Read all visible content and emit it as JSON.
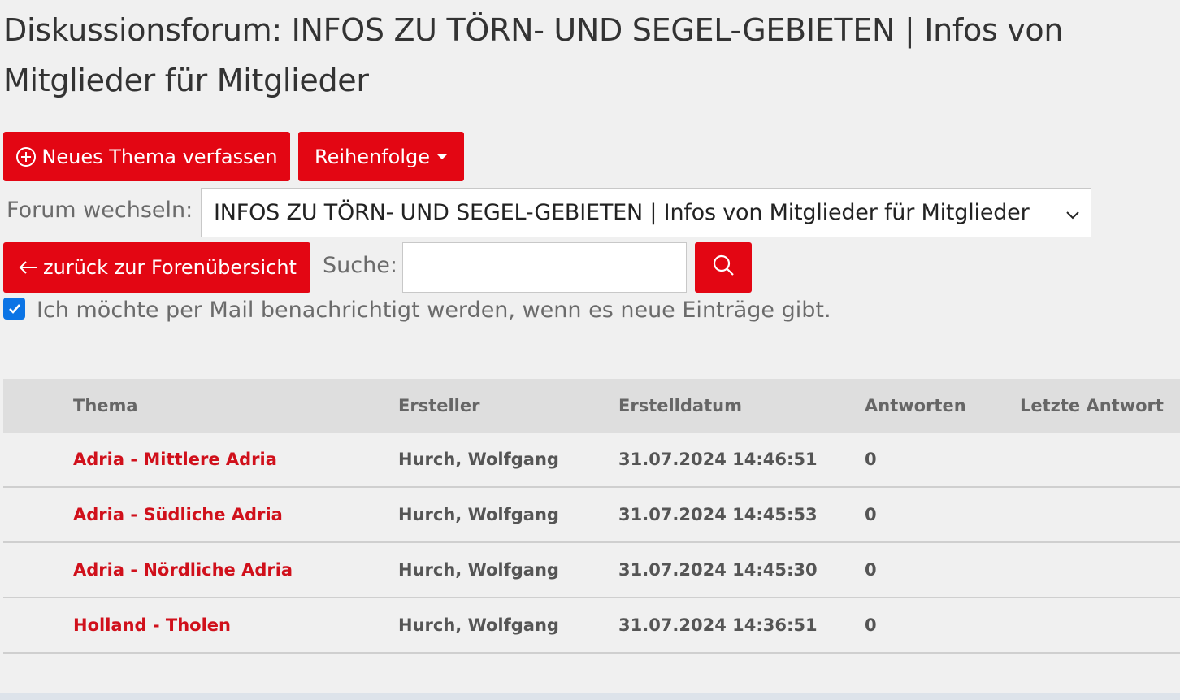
{
  "page": {
    "title": "Diskussionsforum: INFOS ZU TÖRN- UND SEGEL-GEBIETEN | Infos von Mitglieder für Mitglieder"
  },
  "toolbar": {
    "new_topic_label": "Neues Thema verfassen",
    "new_topic_icon": "plus-circle-icon",
    "order_label": "Reihenfolge",
    "order_icon": "caret-down-icon"
  },
  "forum_switch": {
    "label": "Forum wechseln:",
    "selected": "INFOS ZU TÖRN- UND SEGEL-GEBIETEN | Infos von Mitglieder für Mitglieder",
    "icon": "chevron-down-icon"
  },
  "nav": {
    "back_label": "zurück zur Forenübersicht",
    "back_icon": "arrow-left-icon"
  },
  "search": {
    "label": "Suche:",
    "value": "",
    "icon": "search-icon"
  },
  "notify": {
    "checked": true,
    "label": "Ich möchte per Mail benachrichtigt werden, wenn es neue Einträge gibt."
  },
  "table": {
    "headers": [
      "Thema",
      "Ersteller",
      "Erstelldatum",
      "Antworten",
      "Letzte Antwort"
    ],
    "rows": [
      {
        "topic": "Adria - Mittlere Adria",
        "author": "Hurch, Wolfgang",
        "date": "31.07.2024 14:46:51",
        "replies": "0",
        "last": ""
      },
      {
        "topic": "Adria - Südliche Adria",
        "author": "Hurch, Wolfgang",
        "date": "31.07.2024 14:45:53",
        "replies": "0",
        "last": ""
      },
      {
        "topic": "Adria - Nördliche Adria",
        "author": "Hurch, Wolfgang",
        "date": "31.07.2024 14:45:30",
        "replies": "0",
        "last": ""
      },
      {
        "topic": "Holland - Tholen",
        "author": "Hurch, Wolfgang",
        "date": "31.07.2024 14:36:51",
        "replies": "0",
        "last": ""
      }
    ]
  },
  "colors": {
    "accent": "#e30613",
    "link": "#d0101b",
    "checkbox": "#0b74e5",
    "background": "#f0f0f0",
    "header_bg": "#dedede"
  }
}
